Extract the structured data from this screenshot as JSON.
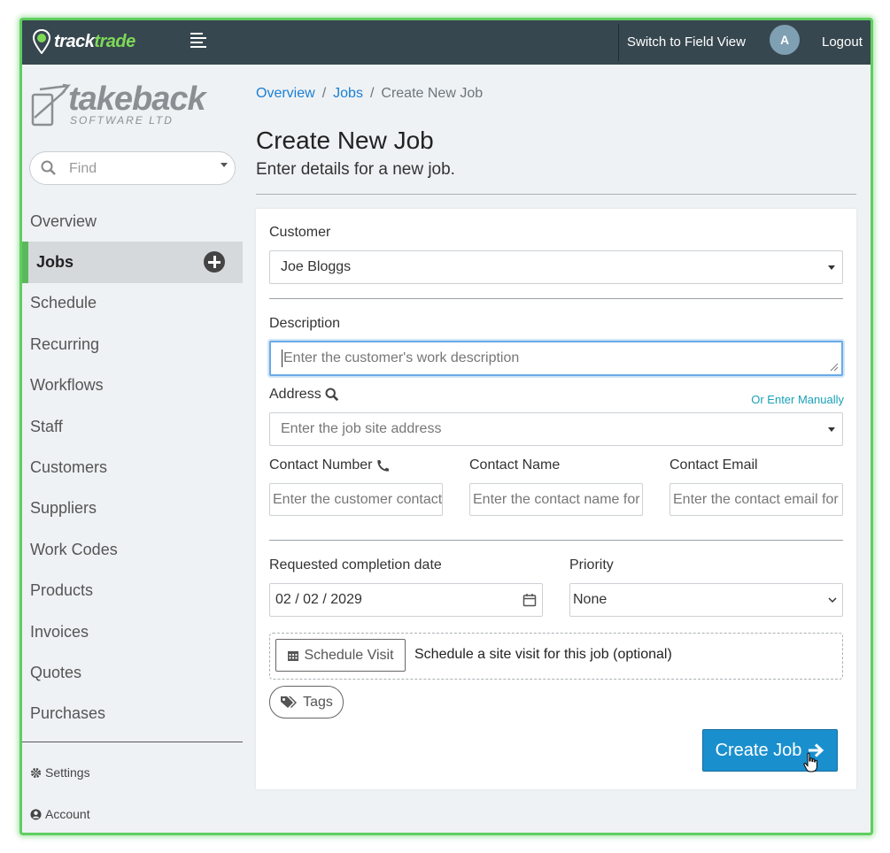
{
  "app": {
    "brand_part1": "track",
    "brand_part2": "trade",
    "switch_label": "Switch to Field View",
    "avatar_initial": "A",
    "logout_label": "Logout"
  },
  "colors": {
    "topbar": "#37474f",
    "accent_green": "#5cb85c",
    "primary_button": "#1a8fce",
    "link": "#1a7fd4"
  },
  "sidebar": {
    "company_name": "takeback",
    "company_sub": "SOFTWARE LTD",
    "search_placeholder": "Find",
    "items": [
      {
        "label": "Overview"
      },
      {
        "label": "Jobs",
        "active": true
      },
      {
        "label": "Schedule"
      },
      {
        "label": "Recurring"
      },
      {
        "label": "Workflows"
      },
      {
        "label": "Staff"
      },
      {
        "label": "Customers"
      },
      {
        "label": "Suppliers"
      },
      {
        "label": "Work Codes"
      },
      {
        "label": "Products"
      },
      {
        "label": "Invoices"
      },
      {
        "label": "Quotes"
      },
      {
        "label": "Purchases"
      }
    ],
    "settings_label": "Settings",
    "account_label": "Account"
  },
  "breadcrumb": {
    "items": [
      "Overview",
      "Jobs",
      "Create New Job"
    ],
    "separator": "/"
  },
  "page": {
    "title": "Create New Job",
    "subtitle": "Enter details for a new job."
  },
  "form": {
    "customer_label": "Customer",
    "customer_value": "Joe Bloggs",
    "description_label": "Description",
    "description_placeholder": "Enter the customer's work description",
    "address_label": "Address",
    "address_manual_link": "Or Enter Manually",
    "address_placeholder": "Enter the job site address",
    "contact_number_label": "Contact Number",
    "contact_number_placeholder": "Enter the customer contact number",
    "contact_name_label": "Contact Name",
    "contact_name_placeholder": "Enter the contact name for the job",
    "contact_email_label": "Contact Email",
    "contact_email_placeholder": "Enter the contact email for the job",
    "date_label": "Requested completion date",
    "date_value": "02 / 02 / 2029",
    "priority_label": "Priority",
    "priority_value": "None",
    "schedule_visit_button": "Schedule Visit",
    "schedule_visit_text": "Schedule a site visit for this job (optional)",
    "tags_button": "Tags",
    "create_button": "Create Job"
  }
}
